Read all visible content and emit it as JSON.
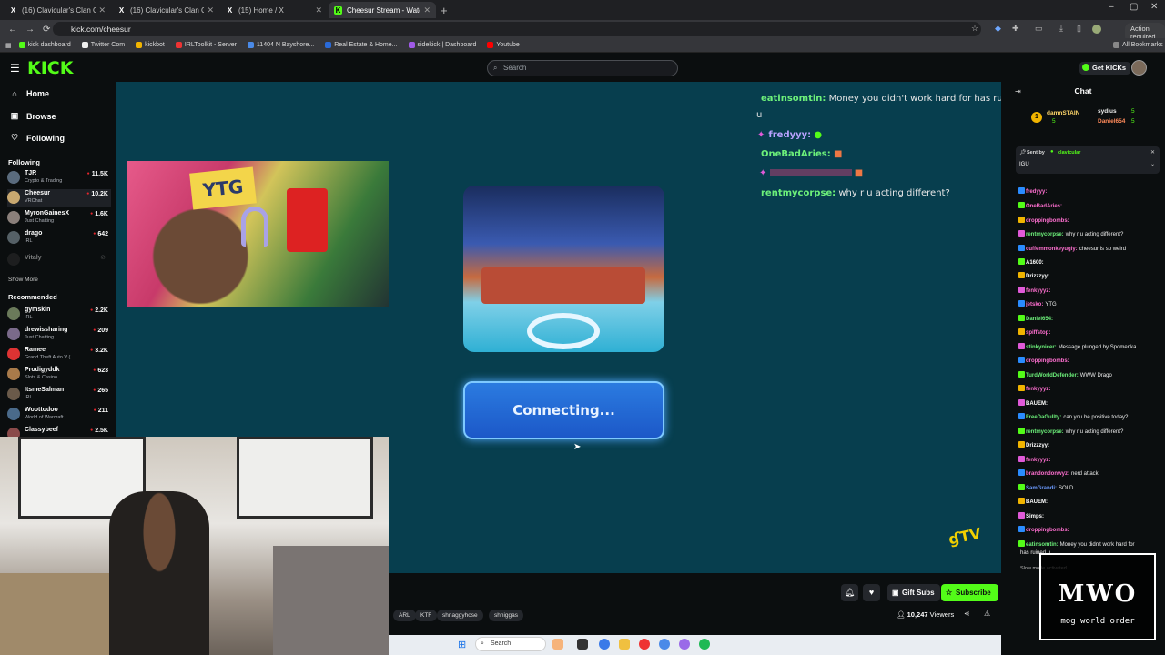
{
  "browser": {
    "tabs": [
      {
        "label": "(16) Clavicular's Clan Communi",
        "icon": "X"
      },
      {
        "label": "(16) Clavicular's Clan Communi",
        "icon": "X"
      },
      {
        "label": "(15) Home / X",
        "icon": "X"
      },
      {
        "label": "Cheesur Stream - Watch Li",
        "icon": "K"
      }
    ],
    "url": "kick.com/cheesur",
    "action_required": "Action required",
    "bookmarks": [
      "kick dashboard",
      "Twitter Com",
      "kickbot",
      "IRLToolkit - Server",
      "11404 N Bayshore...",
      "Real Estate & Home...",
      "sidekick | Dashboard",
      "Youtube"
    ],
    "all_bookmarks": "All Bookmarks"
  },
  "kick": {
    "logo": "KICK",
    "search_placeholder": "Search",
    "get_kicks": "Get KICKs"
  },
  "sidebar": {
    "nav": [
      {
        "label": "Home",
        "icon": "home-icon"
      },
      {
        "label": "Browse",
        "icon": "browse-icon"
      },
      {
        "label": "Following",
        "icon": "heart-icon"
      }
    ],
    "following_title": "Following",
    "following": [
      {
        "name": "TJR",
        "cat": "Crypto & Trading",
        "viewers": "11.5K",
        "color": "#5a6b7d"
      },
      {
        "name": "Cheesur",
        "cat": "VRChat",
        "viewers": "10.2K",
        "color": "#c8a870"
      },
      {
        "name": "MyronGainesX",
        "cat": "Just Chatting",
        "viewers": "1.6K",
        "color": "#8a7f7a"
      },
      {
        "name": "drago",
        "cat": "IRL",
        "viewers": "642",
        "color": "#556066"
      },
      {
        "name": "Vitaly",
        "cat": "",
        "viewers": "",
        "color": "#333"
      }
    ],
    "show_more": "Show More",
    "recommended_title": "Recommended",
    "recommended": [
      {
        "name": "gymskin",
        "cat": "IRL",
        "viewers": "2.2K",
        "color": "#6a7a5a"
      },
      {
        "name": "drewissharing",
        "cat": "Just Chatting",
        "viewers": "209",
        "color": "#7a6a8a"
      },
      {
        "name": "Ramee",
        "cat": "Grand Theft Auto V (...",
        "viewers": "3.2K",
        "color": "#d33"
      },
      {
        "name": "Prodigyddk",
        "cat": "Slots & Casino",
        "viewers": "623",
        "color": "#a87a4a"
      },
      {
        "name": "ItsmeSalman",
        "cat": "IRL",
        "viewers": "265",
        "color": "#6a5a4a"
      },
      {
        "name": "Woottodoo",
        "cat": "World of Warcraft",
        "viewers": "211",
        "color": "#4a6a8a"
      },
      {
        "name": "Classybeef",
        "cat": "",
        "viewers": "2.5K",
        "color": "#8a4a4a"
      }
    ]
  },
  "stream": {
    "overlay_chat": [
      {
        "user": "eatinsomtin:",
        "text": "Money you didn't work hard for has ruined"
      },
      {
        "user": "",
        "text": "u"
      },
      {
        "user": "fredyyy:",
        "text": ""
      },
      {
        "user": "OneBadAries:",
        "text": ""
      },
      {
        "user": "",
        "text": ""
      },
      {
        "user": "rentmycorpse:",
        "text": "why r u acting different?"
      }
    ],
    "connecting": "Connecting...",
    "logo_text": "YTG",
    "ytv": "ɠTV"
  },
  "under": {
    "gift_subs": "Gift Subs",
    "subscribe": "Subscribe",
    "tags": [
      "ARL",
      "KTF",
      "shnaggyhose",
      "shniggas"
    ],
    "viewers_count": "10,247",
    "viewers_label": "Viewers"
  },
  "taskbar": {
    "search": "Search"
  },
  "chat": {
    "title": "Chat",
    "leaders": [
      {
        "name": "damnSTAIN",
        "count": "5"
      },
      {
        "name": "sydius",
        "count": "5"
      },
      {
        "name": "Daniel654",
        "count": "5"
      }
    ],
    "pinned_label": "Sent by",
    "pinned_user": "clavicular",
    "pinned_text": "IGU",
    "messages": [
      {
        "user": "fredyyy:",
        "text": "",
        "color": "#ff6fd0"
      },
      {
        "user": "OneBadAries:",
        "text": "",
        "color": "#ff6fd0"
      },
      {
        "user": "droppingbombs:",
        "text": "",
        "color": "#ff6fd0"
      },
      {
        "user": "rentmycorpse:",
        "text": "why r u acting different?",
        "color": "#6cf07a"
      },
      {
        "user": "cuffemmonkeyugly:",
        "text": "cheesur is so weird",
        "color": "#ff6fd0"
      },
      {
        "user": "A1600:",
        "text": "",
        "color": "#fff"
      },
      {
        "user": "Drizzzyy:",
        "text": "",
        "color": "#fff"
      },
      {
        "user": "fenkyyyz:",
        "text": "",
        "color": "#ff6fd0"
      },
      {
        "user": "jetsko:",
        "text": "YTG",
        "color": "#ff6fd0"
      },
      {
        "user": "Daniel654:",
        "text": "",
        "color": "#6cf07a"
      },
      {
        "user": "spiffstop:",
        "text": "",
        "color": "#ff6fd0"
      },
      {
        "user": "stinkynicer:",
        "text": "Message plunged by Spomenka",
        "color": "#6cf07a"
      },
      {
        "user": "droppingbombs:",
        "text": "",
        "color": "#ff6fd0"
      },
      {
        "user": "TurdWorldDefender:",
        "text": "WWW Drago",
        "color": "#6cf07a"
      },
      {
        "user": "fenkyyyz:",
        "text": "",
        "color": "#ff6fd0"
      },
      {
        "user": "BAUEM:",
        "text": "",
        "color": "#fff"
      },
      {
        "user": "FreeDaGullty:",
        "text": "can you be positive today?",
        "color": "#6cf07a"
      },
      {
        "user": "rentmycorpse:",
        "text": "why r u acting different?",
        "color": "#6cf07a"
      },
      {
        "user": "Drizzzyy:",
        "text": "",
        "color": "#fff"
      },
      {
        "user": "fenkyyyz:",
        "text": "",
        "color": "#ff6fd0"
      },
      {
        "user": "brandondonwyz:",
        "text": "nerd attack",
        "color": "#ff6fd0"
      },
      {
        "user": "SamGrandi:",
        "text": "SOLD",
        "color": "#6c9bff"
      },
      {
        "user": "BAUEM:",
        "text": "",
        "color": "#fff"
      },
      {
        "user": "Simps:",
        "text": "",
        "color": "#fff"
      },
      {
        "user": "droppingbombs:",
        "text": "",
        "color": "#ff6fd0"
      },
      {
        "user": "eatinsomtin:",
        "text": "Money you didn't work hard for",
        "color": "#6cf07a"
      },
      {
        "user": "",
        "text": "has ruined u",
        "color": "#fff"
      }
    ],
    "slow_mode": "Slow mode activated",
    "watermark_big": "MWO",
    "watermark_small": "mog world order"
  }
}
